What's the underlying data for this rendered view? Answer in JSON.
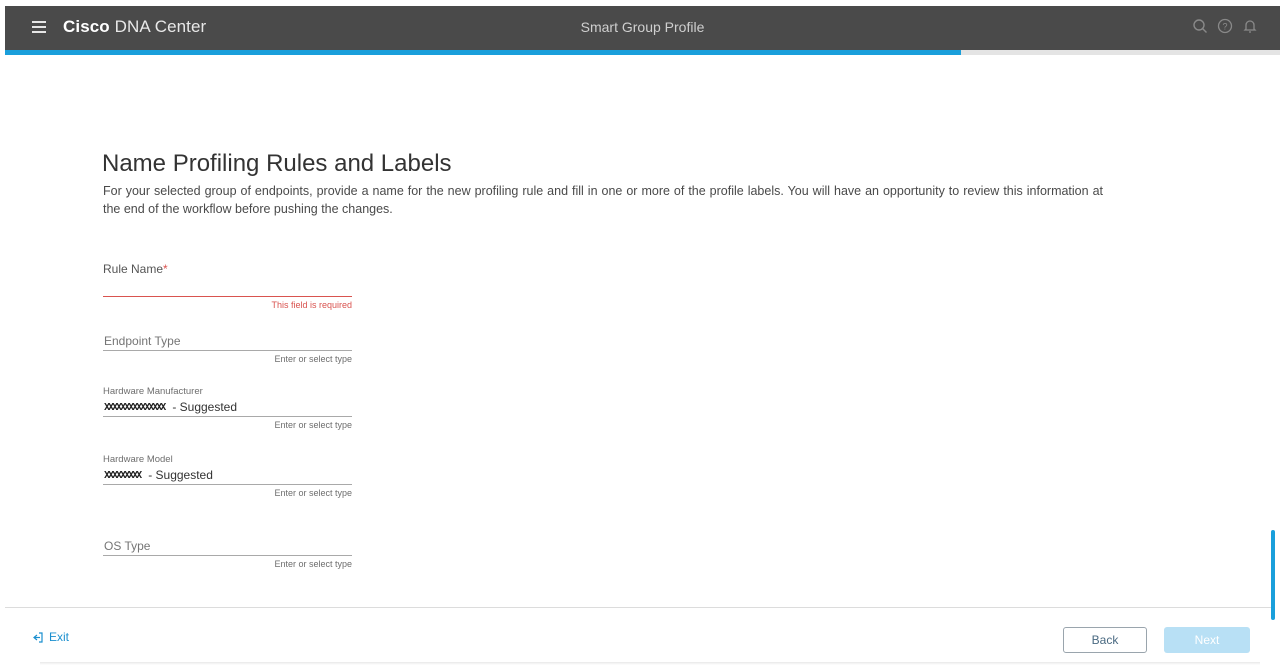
{
  "header": {
    "brand_bold": "Cisco",
    "brand_thin": " DNA Center",
    "title": "Smart Group Profile",
    "icons": [
      "search-icon",
      "help-icon",
      "bell-icon"
    ]
  },
  "progress": {
    "percent": 75,
    "color": "#1a9fdb"
  },
  "page": {
    "title": "Name Profiling Rules and Labels",
    "description": "For your selected group of endpoints, provide a name for the new profiling rule and fill in one or more of the profile labels. You will have an opportunity to review this information at the end of the workflow before pushing the changes."
  },
  "form": {
    "rule_name": {
      "label": "Rule Name",
      "required_mark": "*",
      "value": "",
      "error": "This field is required"
    },
    "endpoint_type": {
      "placeholder": "Endpoint Type",
      "hint": "Enter or select type"
    },
    "hardware_manufacturer": {
      "label": "Hardware Manufacturer",
      "value_redacted": "XXXXXXXXXXXXXXX",
      "suggested": "- Suggested",
      "hint": "Enter or select type"
    },
    "hardware_model": {
      "label": "Hardware Model",
      "value_redacted": "XXXXXXXXX",
      "suggested": "- Suggested",
      "hint": "Enter or select type"
    },
    "os_type": {
      "placeholder": "OS Type",
      "hint": "Enter or select type"
    }
  },
  "footer": {
    "exit_label": "Exit",
    "back_label": "Back",
    "next_label": "Next"
  },
  "colors": {
    "accent": "#1a9fdb",
    "error": "#d9534f",
    "topbar": "#4a4a4a"
  }
}
